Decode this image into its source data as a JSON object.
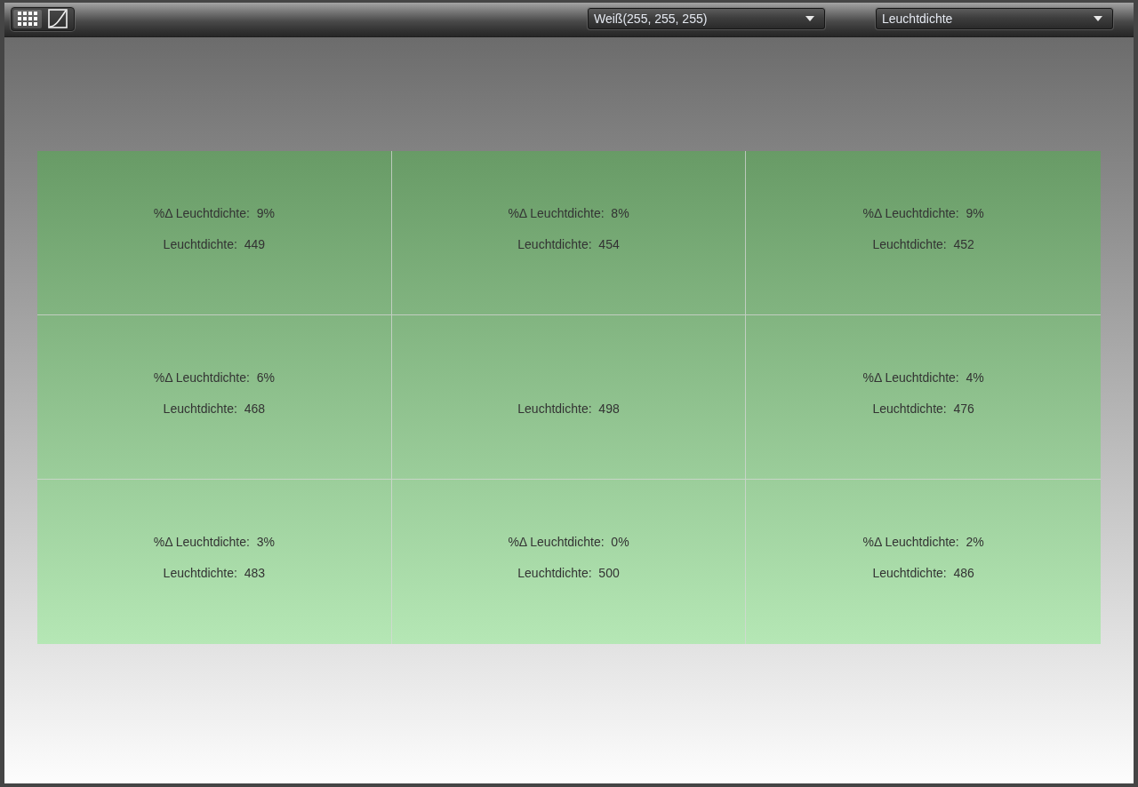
{
  "toolbar": {
    "view_buttons": [
      {
        "kind": "grid",
        "selected": true
      },
      {
        "kind": "curve",
        "selected": false
      }
    ],
    "dropdowns": [
      {
        "value": "Weiß(255, 255, 255)"
      },
      {
        "value": "Leuchtdichte"
      }
    ]
  },
  "grid": {
    "rows": [
      [
        {
          "delta": "%Δ Leuchtdichte:  9%",
          "luminance": "Leuchtdichte:  449"
        },
        {
          "delta": "%Δ Leuchtdichte:  8%",
          "luminance": "Leuchtdichte:  454"
        },
        {
          "delta": "%Δ Leuchtdichte:  9%",
          "luminance": "Leuchtdichte:  452"
        }
      ],
      [
        {
          "delta": "%Δ Leuchtdichte:  6%",
          "luminance": "Leuchtdichte:  468"
        },
        {
          "luminance": "Leuchtdichte:  498"
        },
        {
          "delta": "%Δ Leuchtdichte:  4%",
          "luminance": "Leuchtdichte:  476"
        }
      ],
      [
        {
          "delta": "%Δ Leuchtdichte:  3%",
          "luminance": "Leuchtdichte:  483"
        },
        {
          "delta": "%Δ Leuchtdichte:  0%",
          "luminance": "Leuchtdichte:  500"
        },
        {
          "delta": "%Δ Leuchtdichte:  2%",
          "luminance": "Leuchtdichte:  486"
        }
      ]
    ]
  }
}
